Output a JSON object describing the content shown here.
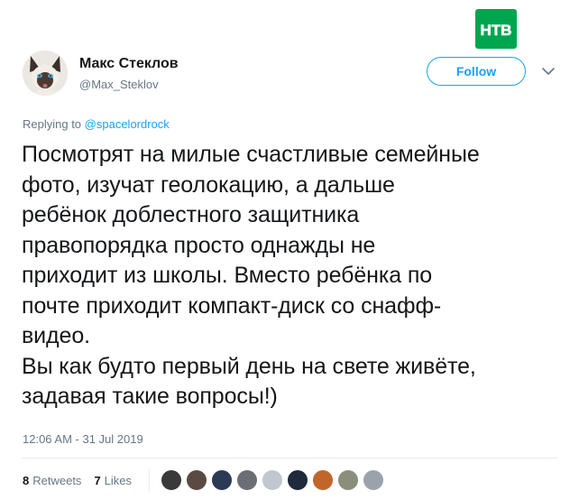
{
  "brand": {
    "logo_icon": "ntv-logo-icon",
    "logo_text": "НТВ",
    "color": "#00a64f"
  },
  "author": {
    "name": "Макс Стеклов",
    "handle": "@Max_Steklov",
    "avatar_icon": "siamese-cat-avatar"
  },
  "follow_button": {
    "label": "Follow"
  },
  "menu": {
    "icon": "chevron-down-icon"
  },
  "reply": {
    "prefix": "Replying to",
    "handle": "@spacelordrock"
  },
  "tweet": {
    "text": "Посмотрят на милые счастливые семейные\nфото, изучат геолокацию, а дальше\nребёнок доблестного защитника\nправопорядка просто однажды не\nприходит из школы. Вместо ребёнка по\nпочте приходит компакт-диск со снафф-\nвидео.\nВы как будто первый день на свете живёте,\nзадавая такие вопросы!)"
  },
  "timestamp": "12:06 AM - 31 Jul 2019",
  "stats": {
    "retweets_count": "8",
    "retweets_label": "Retweets",
    "likes_count": "7",
    "likes_label": "Likes"
  },
  "likers": [
    {
      "name": "liker-avatar-1",
      "color": "#3a3a3a"
    },
    {
      "name": "liker-avatar-2",
      "color": "#5a4a42"
    },
    {
      "name": "liker-avatar-3",
      "color": "#2b3a55"
    },
    {
      "name": "liker-avatar-4",
      "color": "#6b6f75"
    },
    {
      "name": "liker-avatar-5",
      "color": "#bfc7cf"
    },
    {
      "name": "liker-avatar-6",
      "color": "#1f2a3a"
    },
    {
      "name": "liker-avatar-7",
      "color": "#c0662a"
    },
    {
      "name": "liker-avatar-8",
      "color": "#8a8f7a"
    },
    {
      "name": "liker-avatar-9",
      "color": "#9aa3ab"
    }
  ],
  "colors": {
    "accent": "#1da1f2",
    "muted": "#657786",
    "text": "#14171a"
  }
}
